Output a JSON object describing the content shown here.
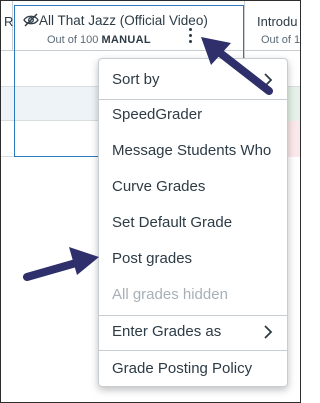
{
  "gradebook": {
    "left_stub_text": "R",
    "active_column": {
      "title": "All That Jazz (Official Video)",
      "subtitle_prefix": "Out of 100",
      "subtitle_badge": "MANUAL"
    },
    "right_column": {
      "title": "Introdu",
      "subtitle": "Out of 1"
    }
  },
  "menu": {
    "items": [
      {
        "label": "Sort by",
        "has_submenu": true,
        "disabled": false
      },
      {
        "label": "SpeedGrader",
        "has_submenu": false,
        "disabled": false
      },
      {
        "label": "Message Students Who",
        "has_submenu": false,
        "disabled": false
      },
      {
        "label": "Curve Grades",
        "has_submenu": false,
        "disabled": false
      },
      {
        "label": "Set Default Grade",
        "has_submenu": false,
        "disabled": false
      },
      {
        "label": "Post grades",
        "has_submenu": false,
        "disabled": false
      },
      {
        "label": "All grades hidden",
        "has_submenu": false,
        "disabled": true
      },
      {
        "label": "Enter Grades as",
        "has_submenu": true,
        "disabled": false
      },
      {
        "label": "Grade Posting Policy",
        "has_submenu": false,
        "disabled": false
      }
    ]
  },
  "colors": {
    "accent_border": "#2b7abc",
    "arrow": "#2f2f6b",
    "disabled_text": "#a7b0b7"
  },
  "icons": {
    "hidden": "eye-slash-icon",
    "options": "kebab-menu-icon",
    "submenu": "chevron-right-icon",
    "annotation": "arrow-annotation"
  }
}
